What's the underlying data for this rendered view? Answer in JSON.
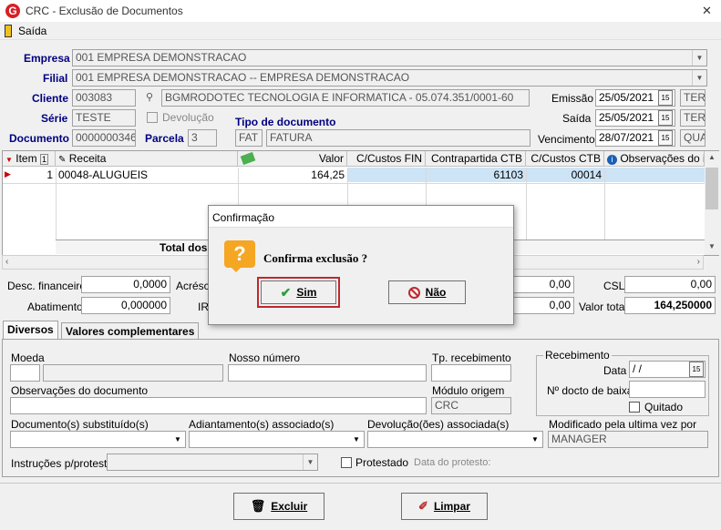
{
  "window": {
    "title": "CRC - Exclusão de Documentos",
    "close_glyph": "✕"
  },
  "menu": {
    "saida": "Saída"
  },
  "form": {
    "empresa_label": "Empresa",
    "empresa_value": "001 EMPRESA DEMONSTRACAO",
    "filial_label": "Filial",
    "filial_value": "001 EMPRESA DEMONSTRACAO -- EMPRESA DEMONSTRACAO",
    "cliente_label": "Cliente",
    "cliente_code": "003083",
    "cliente_name": "BGMRODOTEC TECNOLOGIA  E INFORMATICA - 05.074.351/0001-60",
    "serie_label": "Série",
    "serie_value": "TESTE",
    "devolucao_label": "Devolução",
    "tipo_doc_label": "Tipo de documento",
    "documento_label": "Documento",
    "documento_value": "0000000346",
    "parcela_label": "Parcela",
    "parcela_value": "3",
    "tipo_code": "FAT",
    "tipo_name": "FATURA",
    "emissao_label": "Emissão",
    "emissao_value": "25/05/2021",
    "emissao_day": "TER",
    "saida_label": "Saída",
    "saida_value": "25/05/2021",
    "saida_day": "TER",
    "vencimento_label": "Vencimento",
    "vencimento_value": "28/07/2021",
    "vencimento_day": "QUA"
  },
  "grid": {
    "headers": {
      "item": "Item",
      "sort": "1",
      "receita": "Receita",
      "valor": "Valor",
      "cc_fin": "C/Custos FIN",
      "contrapartida": "Contrapartida CTB",
      "cc_ctb": "C/Custos CTB",
      "obs": "Observações do item"
    },
    "row": {
      "item": "1",
      "receita": "00048-ALUGUEIS",
      "valor": "164,25",
      "contrapartida": "61103",
      "cc_ctb": "00014"
    },
    "total_label": "Total dos"
  },
  "totals": {
    "desc_fin_label": "Desc. financeiro",
    "desc_fin_value": "0,0000",
    "acresc_label": "Acrésc",
    "abatimento_label": "Abatimento",
    "abatimento_value": "0,000000",
    "ir_label": "IR",
    "v1": "0,00",
    "v2": "0,00",
    "csl_label": "CSL",
    "csl_value": "0,00",
    "valor_total_label": "Valor total",
    "valor_total_value": "164,250000"
  },
  "tabs": {
    "diversos": "Diversos",
    "valores": "Valores complementares"
  },
  "diversos": {
    "moeda_label": "Moeda",
    "nosso_numero_label": "Nosso número",
    "tp_recebimento_label": "Tp. recebimento",
    "obs_doc_label": "Observações do documento",
    "modulo_origem_label": "Módulo origem",
    "modulo_origem_value": "CRC",
    "recebimento_label": "Recebimento",
    "data_label": "Data",
    "data_value": " /  /",
    "ndocto_label": "Nº docto de baixa",
    "quitado_label": "Quitado",
    "doc_subst_label": "Documento(s) substituído(s)",
    "adiantamento_label": "Adiantamento(s) associado(s)",
    "devolucoes_label": "Devolução(ões) associada(s)",
    "modificado_label": "Modificado pela ultima vez por",
    "modificado_value": "MANAGER",
    "instrucoes_label": "Instruções p/protesto",
    "protestado_label": "Protestado",
    "data_protesto_label": "Data do protesto:"
  },
  "buttons": {
    "excluir": "Excluir",
    "limpar": "Limpar"
  },
  "dialog": {
    "title": "Confirmação",
    "message": "Confirma exclusão ?",
    "sim": "Sim",
    "nao": "Não",
    "icon_glyph": "?"
  },
  "colors": {
    "accent_blue": "#000080",
    "selected_row": "#cde4f7",
    "dialog_icon": "#f5a623",
    "focus_border": "#c0272d"
  }
}
